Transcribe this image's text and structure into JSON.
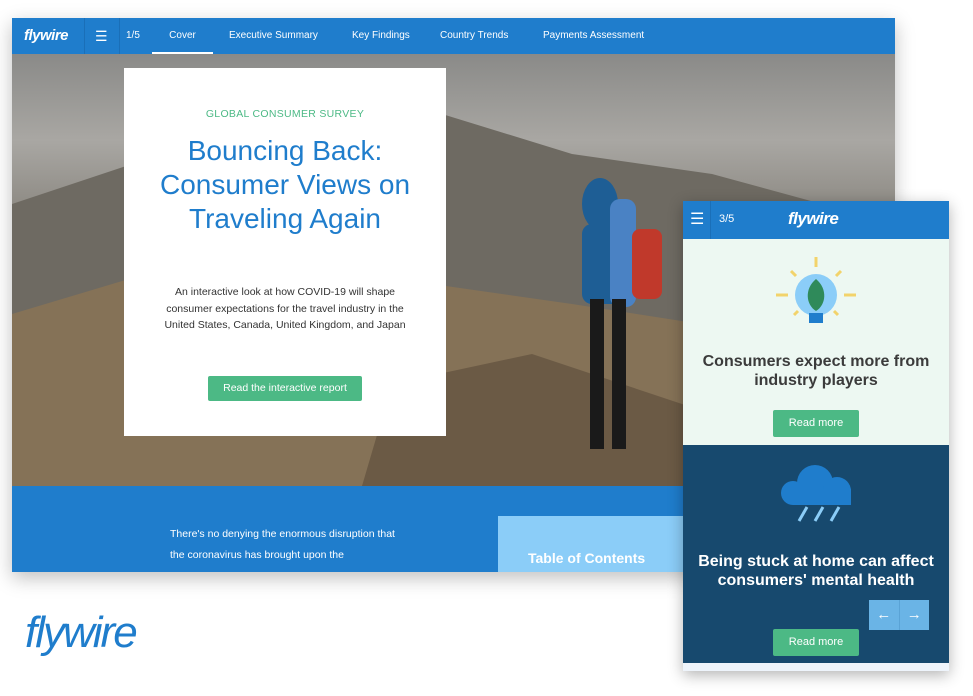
{
  "brand": {
    "logo": "flywire",
    "accent": "#1f7dcc",
    "green": "#4cb985"
  },
  "desktop": {
    "nav": {
      "page": "1/5",
      "tabs": [
        {
          "label": "Cover",
          "active": true
        },
        {
          "label": "Executive Summary"
        },
        {
          "label": "Key Findings"
        },
        {
          "label": "Country Trends"
        },
        {
          "label": "Payments Assessment"
        }
      ]
    },
    "hero": {
      "eyebrow": "GLOBAL CONSUMER SURVEY",
      "title": "Bouncing Back: Consumer Views on Traveling Again",
      "description": "An interactive look at how COVID-19 will shape consumer expectations for the travel industry in the United States, Canada, United Kingdom, and Japan",
      "cta": "Read the interactive report"
    },
    "intro": "There's no denying the enormous disruption that the coronavirus has brought upon the",
    "toc": "Table of Contents"
  },
  "mobile": {
    "page": "3/5",
    "cards": [
      {
        "title": "Consumers expect more from industry players",
        "cta": "Read more",
        "icon": "lightbulb-leaf-icon"
      },
      {
        "title": "Being stuck at home can affect consumers' mental health",
        "cta": "Read more",
        "icon": "rain-cloud-icon"
      }
    ],
    "prev": "←",
    "next": "→"
  }
}
